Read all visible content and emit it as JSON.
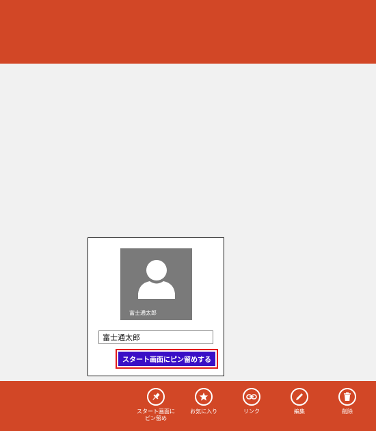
{
  "pin_flyout": {
    "tile_name": "富士通太郎",
    "name_input_value": "富士通太郎",
    "pin_button_label": "スタート画面にピン留めする"
  },
  "app_bar": {
    "commands": [
      {
        "label_line1": "スタート画面に",
        "label_line2": "ピン留め",
        "icon": "pin-icon"
      },
      {
        "label": "お気に入り",
        "icon": "star-icon"
      },
      {
        "label": "リンク",
        "icon": "link-icon"
      },
      {
        "label": "編集",
        "icon": "edit-icon"
      },
      {
        "label": "削除",
        "icon": "trash-icon"
      }
    ]
  },
  "colors": {
    "accent_orange": "#d24726",
    "pin_button": "#3a0fc6",
    "highlight_red": "#e21b1b",
    "tile_gray": "#7a7a7a",
    "background": "#f1f1f1"
  }
}
